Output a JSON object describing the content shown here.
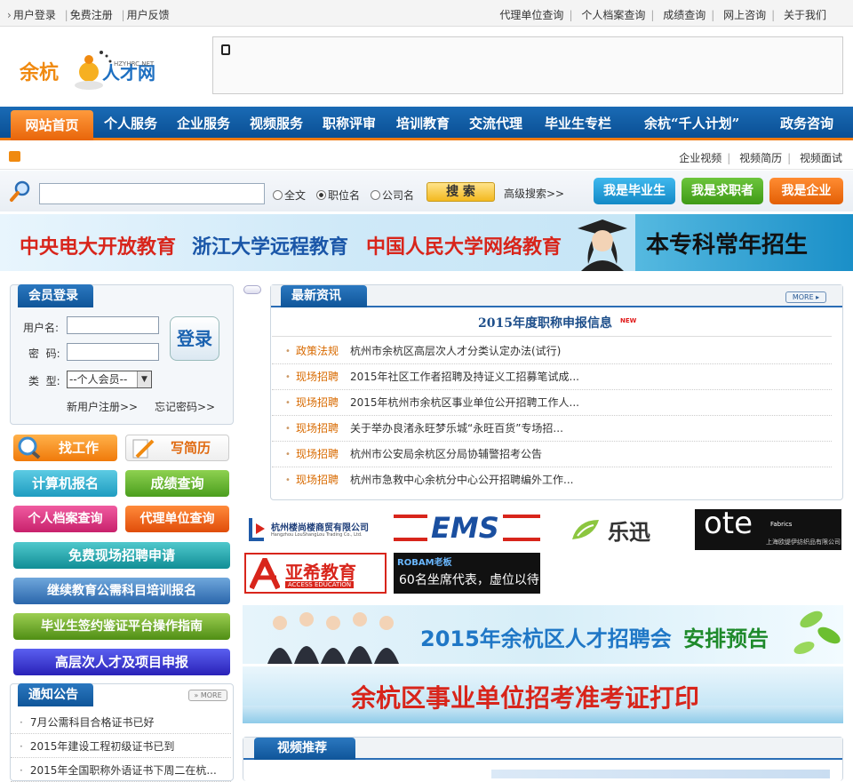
{
  "topbar": {
    "left": [
      "用户登录",
      "免费注册",
      "用户反馈"
    ],
    "right": [
      "代理单位查询",
      "个人档案查询",
      "成绩查询",
      "网上咨询",
      "关于我们"
    ]
  },
  "logo": {
    "text": "余杭人才网",
    "sub": "HZYHRC.NET"
  },
  "nav": {
    "home": "网站首页",
    "items": [
      "个人服务",
      "企业服务",
      "视频服务",
      "职称评审",
      "培训教育",
      "交流代理",
      "毕业生专栏",
      "余杭“千人计划”",
      "政务咨询"
    ]
  },
  "subnav": {
    "links": [
      "企业视频",
      "视频简历",
      "视频面试"
    ]
  },
  "search": {
    "options": [
      "全文",
      "职位名",
      "公司名"
    ],
    "selected": "职位名",
    "button": "搜 索",
    "advanced": "高级搜索>>",
    "roles": [
      "我是毕业生",
      "我是求职者",
      "我是企业"
    ],
    "role_colors": [
      "#1a9bd7",
      "#48a81c",
      "#ee6a0a"
    ]
  },
  "banner": {
    "items": [
      "中央电大开放教育",
      "浙江大学远程教育",
      "中国人民大学网络教育"
    ],
    "right": "本专科常年招生"
  },
  "login": {
    "title": "会员登录",
    "username_label": "用户名:",
    "password_label": "密  码:",
    "type_label": "类  型:",
    "type_value": "--个人会员--",
    "login_button": "登录",
    "register": "新用户注册>>",
    "forgot": "忘记密码>>"
  },
  "services": {
    "find_job": "找工作",
    "write_resume": "写简历",
    "computer_reg": "计算机报名",
    "score_query": "成绩查询",
    "archive_query": "个人档案查询",
    "agency_query": "代理单位查询",
    "free_recruit": "免费现场招聘申请",
    "continuing_edu": "继续教育公需科目培训报名",
    "graduate_guide": "毕业生签约鉴证平台操作指南",
    "talent_project": "高层次人才及项目申报"
  },
  "notices": {
    "title": "通知公告",
    "more": "MORE",
    "items": [
      "7月公需科目合格证书已好",
      "2015年建设工程初级证书已到",
      "2015年全国职称外语证书下周二在杭..."
    ]
  },
  "news": {
    "title": "最新资讯",
    "more": "MORE",
    "headline": "2015年度职称申报信息",
    "new_badge": "NEW",
    "items": [
      {
        "cat": "政策法规",
        "title": "杭州市余杭区高层次人才分类认定办法(试行)"
      },
      {
        "cat": "现场招聘",
        "title": "2015年社区工作者招聘及持证义工招募笔试成..."
      },
      {
        "cat": "现场招聘",
        "title": "2015年杭州市余杭区事业单位公开招聘工作人..."
      },
      {
        "cat": "现场招聘",
        "title": "关于举办良渚永旺梦乐城“永旺百货”专场招..."
      },
      {
        "cat": "现场招聘",
        "title": "杭州市公安局余杭区分局协辅警招考公告"
      },
      {
        "cat": "现场招聘",
        "title": "杭州市急救中心余杭分中心公开招聘编外工作..."
      }
    ]
  },
  "logos": {
    "lsx": "杭州楼尚楼商贸有限公司",
    "lsx_en": "Hangzhou LouShangLou Trading Co., Ltd.",
    "ems": "EMS",
    "lexun": "乐迅",
    "ote": "ote",
    "ote_sub": "Fabrics",
    "ote_cn": "上海欧缇伊纺织品有限公司",
    "yaxi": "亚希教育",
    "yaxi_en": "ACCESS EDUCATION",
    "robam": "ROBAM老板",
    "seats": "60名坐席代表，虚位以待"
  },
  "promo": {
    "fair": "2015年余杭区人才招聘会",
    "fair_sub": "安排预告",
    "exam": "余杭区事业单位招考准考证打印"
  },
  "video": {
    "title": "视频推荐"
  }
}
